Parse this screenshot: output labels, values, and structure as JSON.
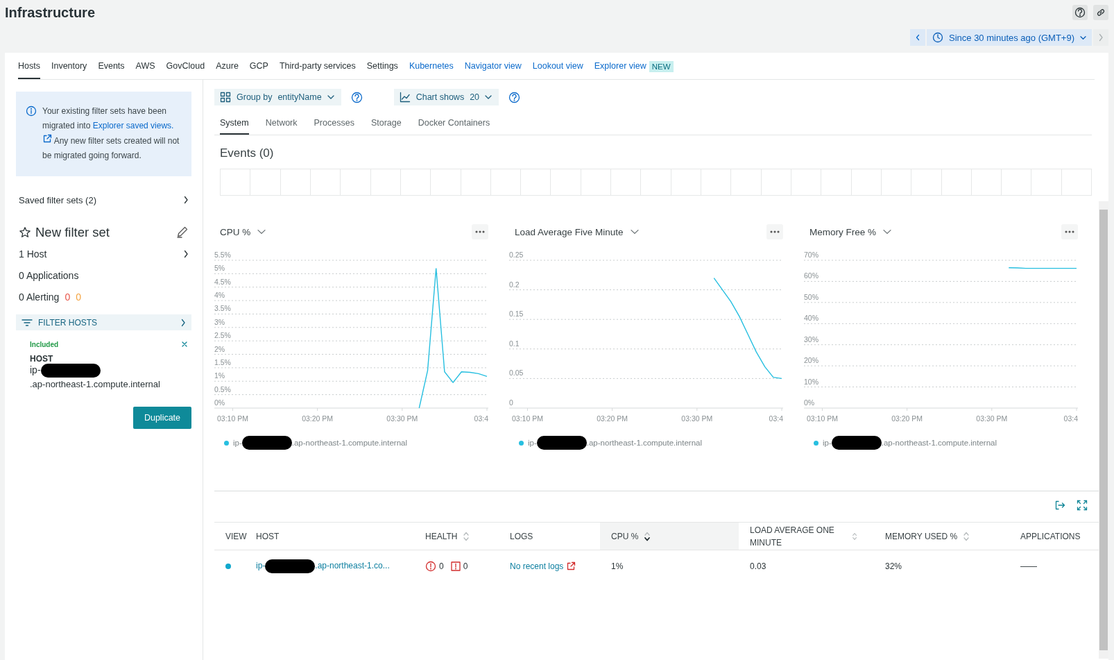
{
  "page_title": "Infrastructure",
  "time_picker": {
    "label": "Since 30 minutes ago (GMT+9)",
    "prev_disabled": false,
    "next_disabled": true
  },
  "tabs": [
    {
      "label": "Hosts",
      "kind": "page",
      "selected": true
    },
    {
      "label": "Inventory",
      "kind": "page",
      "selected": false
    },
    {
      "label": "Events",
      "kind": "page",
      "selected": false
    },
    {
      "label": "AWS",
      "kind": "page",
      "selected": false
    },
    {
      "label": "GovCloud",
      "kind": "page",
      "selected": false
    },
    {
      "label": "Azure",
      "kind": "page",
      "selected": false
    },
    {
      "label": "GCP",
      "kind": "page",
      "selected": false
    },
    {
      "label": "Third-party services",
      "kind": "page",
      "selected": false
    },
    {
      "label": "Settings",
      "kind": "page",
      "selected": false
    },
    {
      "label": "Kubernetes",
      "kind": "view",
      "selected": false
    },
    {
      "label": "Navigator view",
      "kind": "view",
      "selected": false
    },
    {
      "label": "Lookout view",
      "kind": "view",
      "selected": false
    },
    {
      "label": "Explorer view",
      "kind": "view",
      "selected": false,
      "badge": "NEW"
    }
  ],
  "notice": {
    "text_before": "Your existing filter sets have been migrated into",
    "link": "Explorer saved views.",
    "text_after": "Any new filter sets created will not be migrated going forward."
  },
  "saved_filter_sets": "Saved filter sets (2)",
  "filter_set": {
    "title": "New filter set",
    "starred": false
  },
  "summary": [
    {
      "label": "1 Host",
      "expandable": true
    },
    {
      "label": "0 Applications",
      "expandable": false
    },
    {
      "label": "0 Alerting",
      "expandable": false,
      "counts": [
        {
          "value": "0",
          "color": "#e8564a"
        },
        {
          "value": "0",
          "color": "#f4a340"
        }
      ]
    }
  ],
  "filter_hosts": {
    "label": "FILTER HOSTS",
    "status": "Included",
    "field": "HOST",
    "value_prefix": "ip-",
    "value_suffix": ".ap-northeast-1.compute.internal"
  },
  "duplicate_button": "Duplicate",
  "toolbar": {
    "group_by_label": "Group by",
    "group_by_value": "entityName",
    "chart_shows_label": "Chart shows",
    "chart_shows_value": "20"
  },
  "subtabs": [
    {
      "label": "System",
      "selected": true
    },
    {
      "label": "Network",
      "selected": false
    },
    {
      "label": "Processes",
      "selected": false
    },
    {
      "label": "Storage",
      "selected": false
    },
    {
      "label": "Docker Containers",
      "selected": false
    }
  ],
  "events": {
    "title": "Events (0)"
  },
  "charts": [
    {
      "title": "CPU %",
      "legend_prefix": "ip-",
      "legend_suffix": ".ap-northeast-1.compute.internal",
      "chart_data": {
        "type": "line",
        "grid": true,
        "ylim": [
          0,
          5.5
        ],
        "categories": [
          "03:10 PM",
          null,
          null,
          null,
          null,
          null,
          null,
          null,
          null,
          null,
          "03:20 PM",
          null,
          null,
          null,
          null,
          null,
          null,
          null,
          null,
          null,
          "03:30 PM",
          null,
          null,
          null,
          null,
          null,
          null,
          null,
          null,
          null,
          "03:4"
        ],
        "yticks": [
          {
            "value": 0,
            "label": "0%"
          },
          {
            "value": 0.5,
            "label": "0.5%"
          },
          {
            "value": 1,
            "label": "1%"
          },
          {
            "value": 1.5,
            "label": "1.5%"
          },
          {
            "value": 2,
            "label": "2%"
          },
          {
            "value": 2.5,
            "label": "2.5%"
          },
          {
            "value": 3,
            "label": "3%"
          },
          {
            "value": 3.5,
            "label": "3.5%"
          },
          {
            "value": 4,
            "label": "4%"
          },
          {
            "value": 4.5,
            "label": "4.5%"
          },
          {
            "value": 5,
            "label": "5%"
          },
          {
            "value": 5.5,
            "label": "5.5%"
          }
        ],
        "series": [
          {
            "color": "#27bfe0",
            "values": [
              null,
              null,
              null,
              null,
              null,
              null,
              null,
              null,
              null,
              null,
              null,
              null,
              null,
              null,
              null,
              null,
              null,
              null,
              null,
              null,
              null,
              null,
              0,
              1.4,
              5.2,
              1.35,
              0.95,
              1.35,
              1.33,
              1.28,
              1.18
            ]
          }
        ]
      }
    },
    {
      "title": "Load Average Five Minute",
      "legend_prefix": "ip-",
      "legend_suffix": ".ap-northeast-1.compute.internal",
      "chart_data": {
        "type": "line",
        "grid": true,
        "ylim": [
          0,
          0.25
        ],
        "categories": [
          "03:10 PM",
          null,
          null,
          null,
          null,
          null,
          null,
          null,
          null,
          null,
          "03:20 PM",
          null,
          null,
          null,
          null,
          null,
          null,
          null,
          null,
          null,
          "03:30 PM",
          null,
          null,
          null,
          null,
          null,
          null,
          null,
          null,
          null,
          "03:4"
        ],
        "yticks": [
          0,
          0.05,
          0.1,
          0.15,
          0.2,
          0.25
        ],
        "series": [
          {
            "color": "#27bfe0",
            "values": [
              null,
              null,
              null,
              null,
              null,
              null,
              null,
              null,
              null,
              null,
              null,
              null,
              null,
              null,
              null,
              null,
              null,
              null,
              null,
              null,
              null,
              null,
              0.22,
              0.2,
              0.18,
              0.155,
              0.125,
              0.095,
              0.07,
              0.052,
              0.05
            ]
          }
        ]
      }
    },
    {
      "title": "Memory Free %",
      "legend_prefix": "ip-",
      "legend_suffix": ".ap-northeast-1.compute.internal",
      "chart_data": {
        "type": "line",
        "grid": true,
        "ylim": [
          0,
          70
        ],
        "categories": [
          "03:10 PM",
          null,
          null,
          null,
          null,
          null,
          null,
          null,
          null,
          null,
          "03:20 PM",
          null,
          null,
          null,
          null,
          null,
          null,
          null,
          null,
          null,
          "03:30 PM",
          null,
          null,
          null,
          null,
          null,
          null,
          null,
          null,
          null,
          "03:4"
        ],
        "yticks": [
          {
            "value": 0,
            "label": "0%"
          },
          {
            "value": 10,
            "label": "10%"
          },
          {
            "value": 20,
            "label": "20%"
          },
          {
            "value": 30,
            "label": "30%"
          },
          {
            "value": 40,
            "label": "40%"
          },
          {
            "value": 50,
            "label": "50%"
          },
          {
            "value": 60,
            "label": "60%"
          },
          {
            "value": 70,
            "label": "70%"
          }
        ],
        "series": [
          {
            "color": "#27bfe0",
            "values": [
              null,
              null,
              null,
              null,
              null,
              null,
              null,
              null,
              null,
              null,
              null,
              null,
              null,
              null,
              null,
              null,
              null,
              null,
              null,
              null,
              null,
              null,
              66.5,
              66.4,
              66.2,
              66.2,
              66.2,
              66.2,
              66.2,
              66.2,
              66.2
            ]
          }
        ]
      }
    }
  ],
  "table": {
    "columns": [
      {
        "label": "VIEW",
        "sortable": false,
        "sorted": false
      },
      {
        "label": "HOST",
        "sortable": false,
        "sorted": false
      },
      {
        "label": "HEALTH",
        "sortable": true,
        "sorted": false
      },
      {
        "label": "LOGS",
        "sortable": false,
        "sorted": false
      },
      {
        "label": "CPU %",
        "sortable": true,
        "sorted": true
      },
      {
        "label": "LOAD AVERAGE ONE MINUTE",
        "sortable": true,
        "sorted": false
      },
      {
        "label": "MEMORY USED %",
        "sortable": true,
        "sorted": false
      },
      {
        "label": "APPLICATIONS",
        "sortable": false,
        "sorted": false
      }
    ],
    "rows": [
      {
        "color": "#11a8cd",
        "host_prefix": "ip-",
        "host_suffix": ".ap-northeast-1.co...",
        "critical": "0",
        "warning": "0",
        "logs": "No recent logs",
        "cpu": "1%",
        "load": "0.03",
        "memory": "32%",
        "applications": "——"
      }
    ]
  }
}
